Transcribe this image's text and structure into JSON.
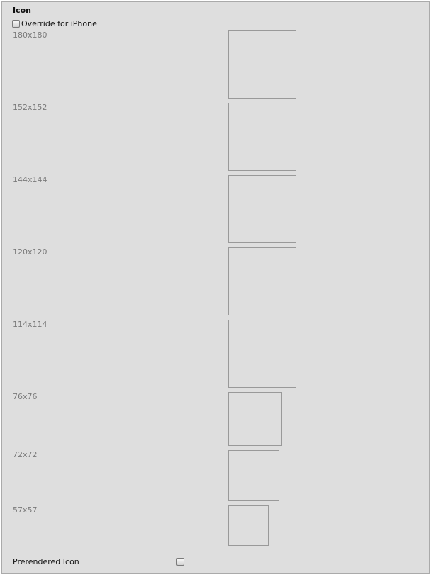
{
  "section": {
    "title": "Icon"
  },
  "override": {
    "label": "Override for iPhone",
    "checked": false
  },
  "icons": [
    {
      "label": "180x180"
    },
    {
      "label": "152x152"
    },
    {
      "label": "144x144"
    },
    {
      "label": "120x120"
    },
    {
      "label": "114x114"
    },
    {
      "label": "76x76"
    },
    {
      "label": "72x72"
    },
    {
      "label": "57x57"
    }
  ],
  "prerendered": {
    "label": "Prerendered Icon",
    "checked": false
  }
}
